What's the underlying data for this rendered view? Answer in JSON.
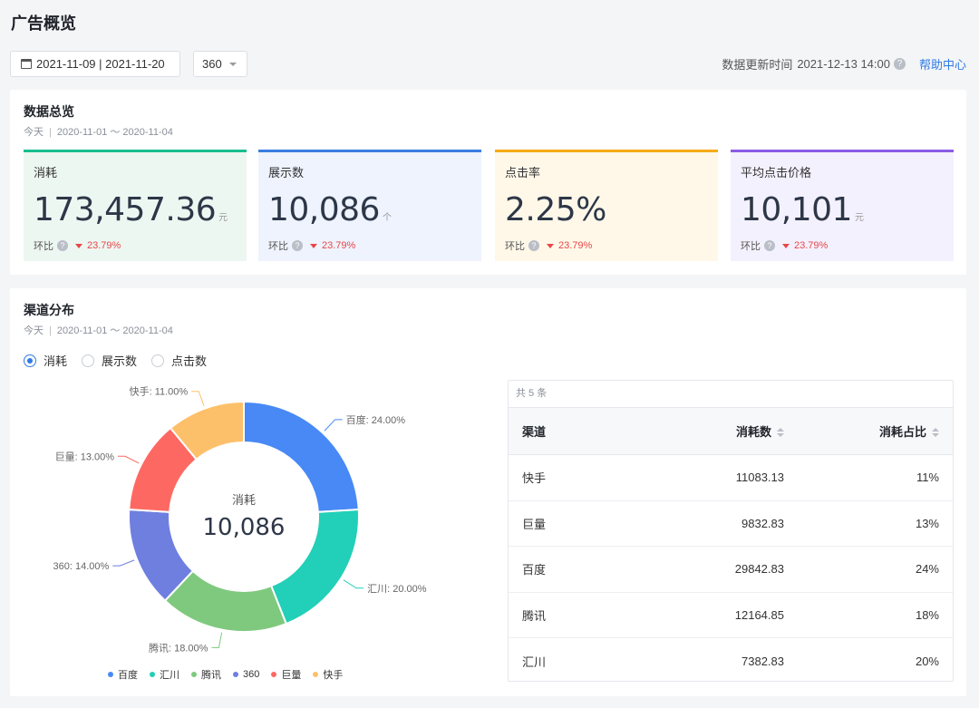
{
  "page": {
    "title": "广告概览"
  },
  "toolbar": {
    "date_range": "2021-11-09 | 2021-11-20",
    "channel": "360",
    "update_label": "数据更新时间",
    "update_time": "2021-12-13 14:00",
    "help_link": "帮助中心"
  },
  "overview": {
    "title": "数据总览",
    "sub_today": "今天",
    "sub_range": "2020-11-01 ～ 2020-11-04",
    "compare_label": "环比",
    "metrics": [
      {
        "label": "消耗",
        "value": "173,457.36",
        "unit": "元",
        "change": "23.79%",
        "accent": "#19be8c",
        "bg": "#edf7f2"
      },
      {
        "label": "展示数",
        "value": "10,086",
        "unit": "个",
        "change": "23.79%",
        "accent": "#3a7de0",
        "bg": "#eef3fd"
      },
      {
        "label": "点击率",
        "value": "2.25%",
        "unit": "",
        "change": "23.79%",
        "accent": "#f5ab17",
        "bg": "#fff8e9"
      },
      {
        "label": "平均点击价格",
        "value": "10,101",
        "unit": "元",
        "change": "23.79%",
        "accent": "#8c5ce6",
        "bg": "#f4f1fe"
      }
    ]
  },
  "channel": {
    "title": "渠道分布",
    "sub_today": "今天",
    "sub_range": "2020-11-01 ～ 2020-11-04",
    "radios": [
      {
        "label": "消耗",
        "checked": true
      },
      {
        "label": "展示数",
        "checked": false
      },
      {
        "label": "点击数",
        "checked": false
      }
    ],
    "center_label": "消耗",
    "center_value": "10,086",
    "table": {
      "count_text": "共 5 条",
      "headers": [
        "渠道",
        "消耗数",
        "消耗占比"
      ],
      "rows": [
        [
          "快手",
          "11083.13",
          "11%"
        ],
        [
          "巨量",
          "9832.83",
          "13%"
        ],
        [
          "百度",
          "29842.83",
          "24%"
        ],
        [
          "腾讯",
          "12164.85",
          "18%"
        ],
        [
          "汇川",
          "7382.83",
          "20%"
        ]
      ]
    }
  },
  "chart_data": {
    "type": "pie",
    "categories": [
      "百度",
      "汇川",
      "腾讯",
      "360",
      "巨量",
      "快手"
    ],
    "values": [
      24,
      20,
      18,
      14,
      13,
      11
    ],
    "slice_labels": [
      "百度: 24.00%",
      "汇川: 20.00%",
      "腾讯: 18.00%",
      "360: 14.00%",
      "巨量: 13.00%",
      "快手: 11.00%"
    ],
    "colors": [
      "#4889f5",
      "#22cfb8",
      "#7fc97f",
      "#6e7fe0",
      "#fd6962",
      "#fdc06a"
    ],
    "legend": "bottom",
    "donut": true
  }
}
